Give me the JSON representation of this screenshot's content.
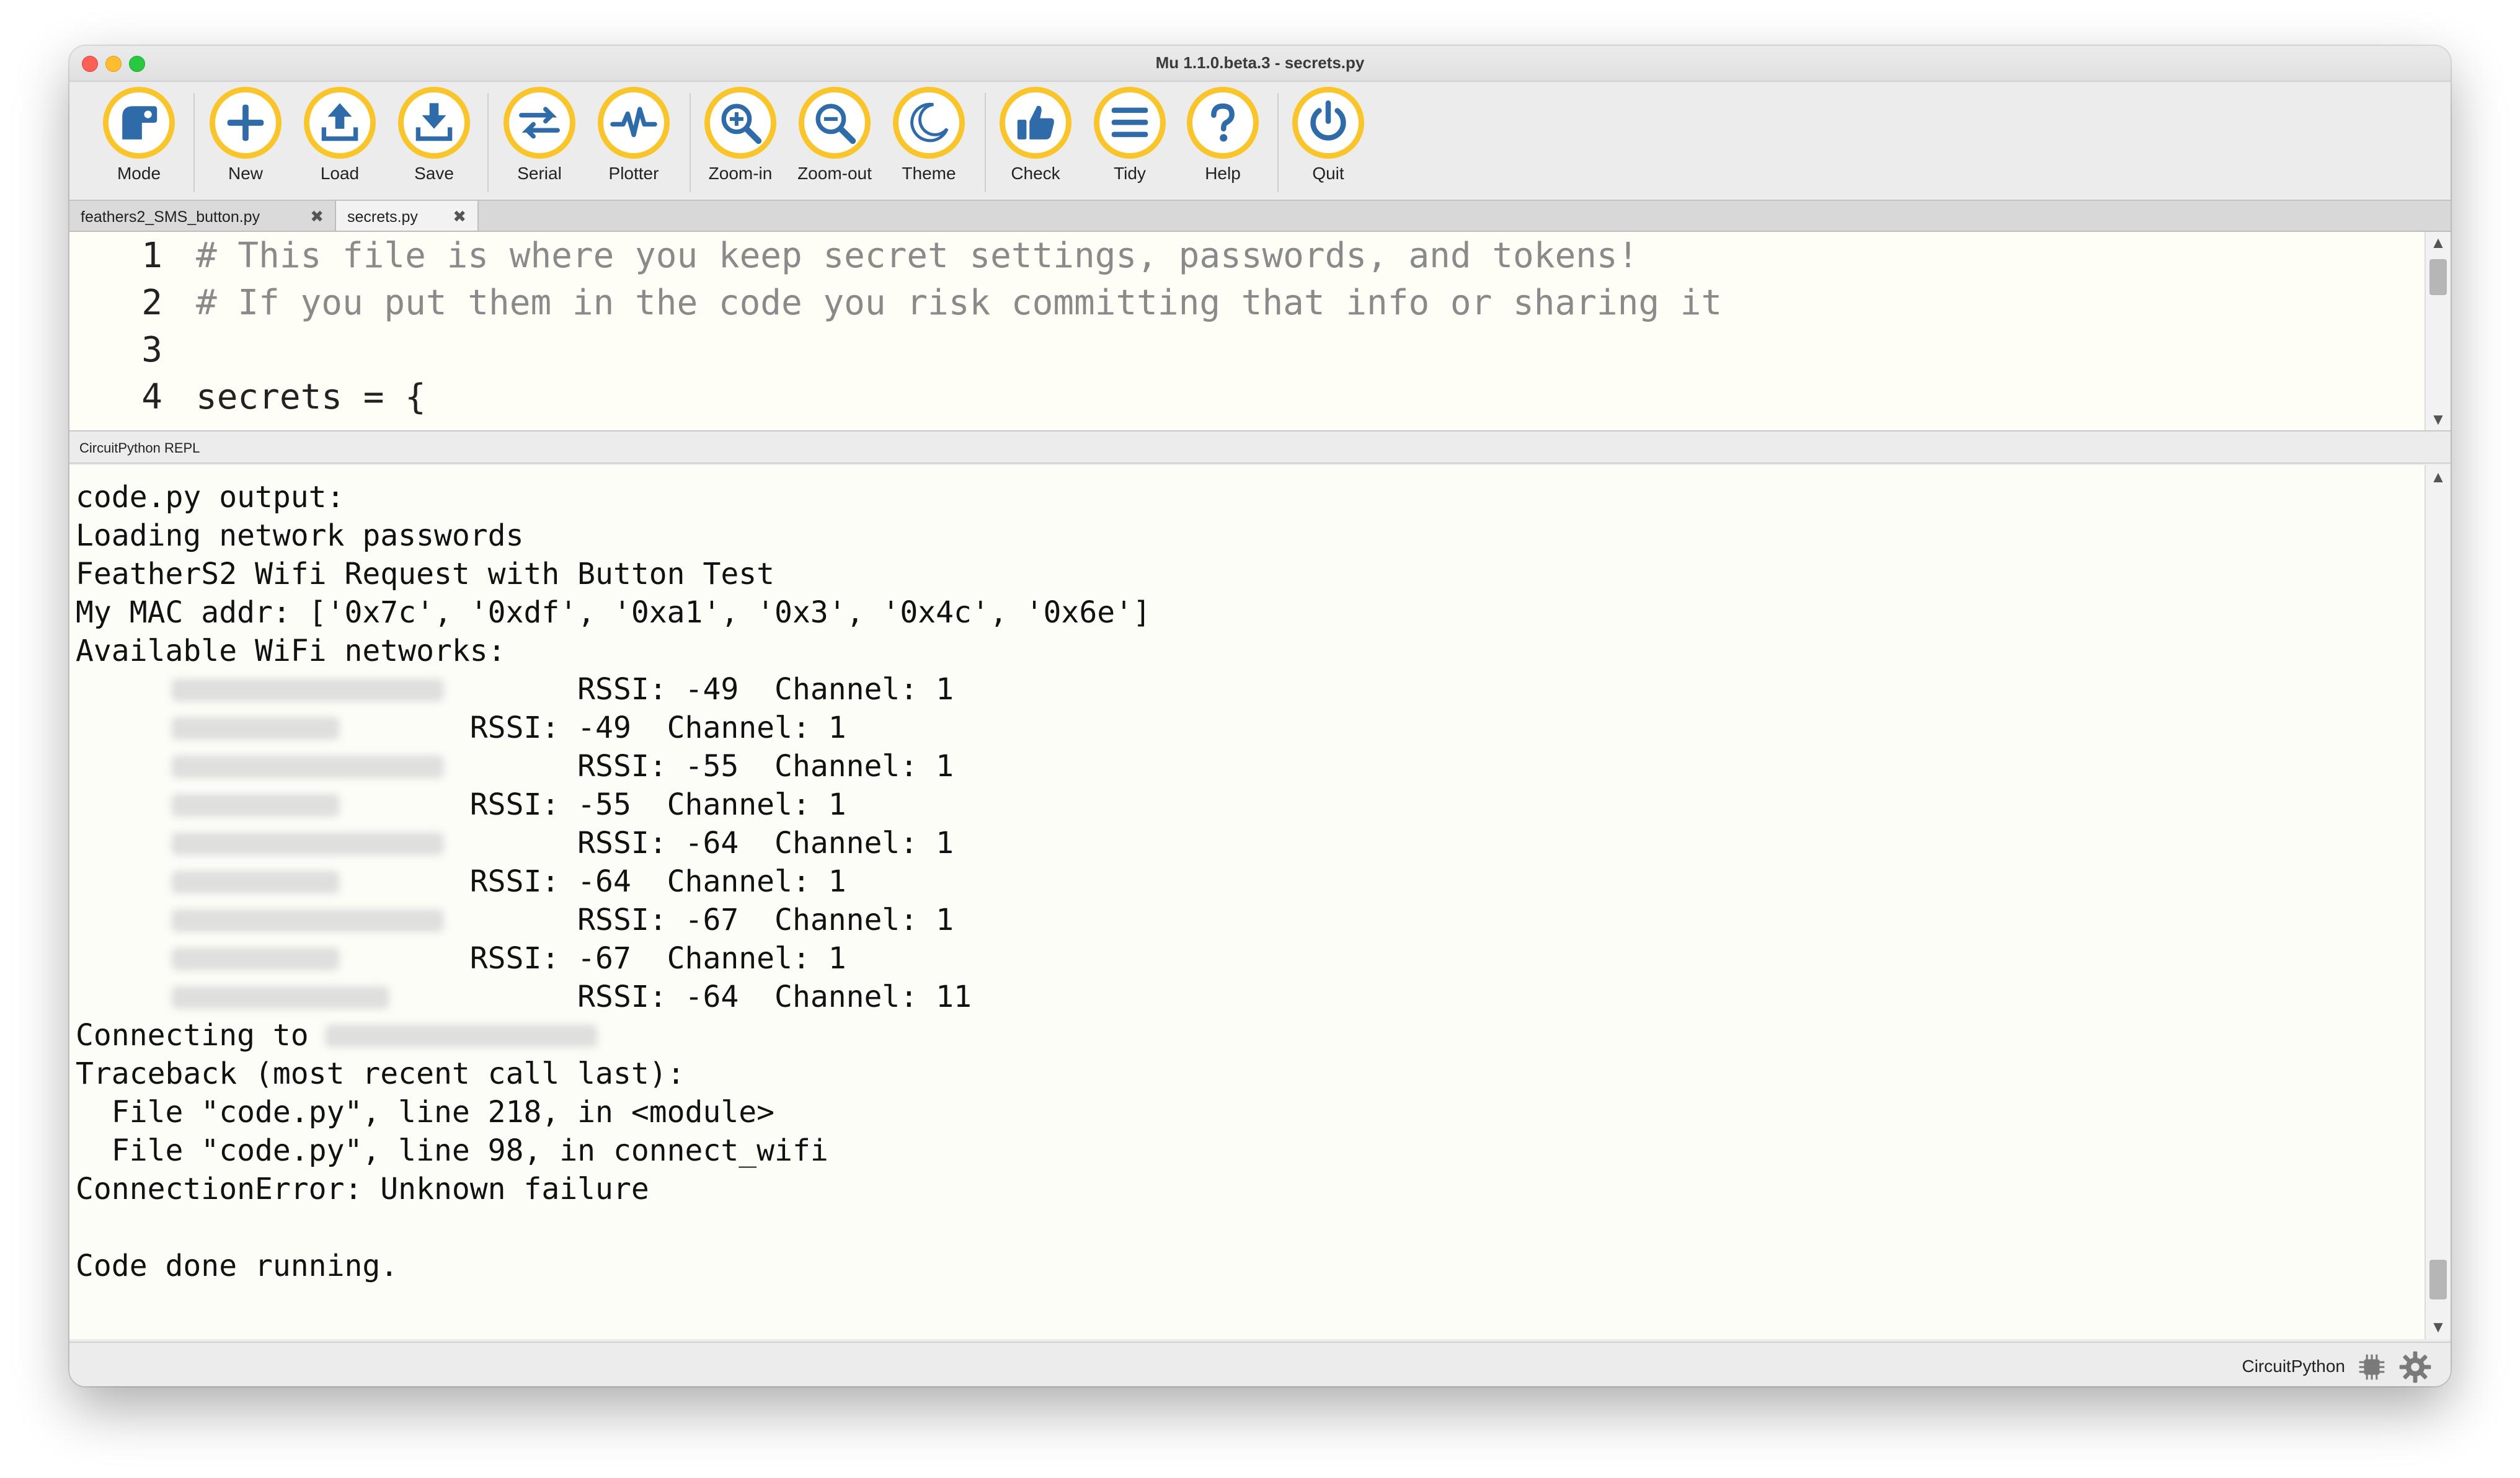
{
  "window": {
    "title": "Mu 1.1.0.beta.3 - secrets.py"
  },
  "toolbar": {
    "buttons": [
      {
        "label": "Mode",
        "icon": "mode-icon"
      },
      {
        "label": "New",
        "icon": "plus-icon"
      },
      {
        "label": "Load",
        "icon": "upload-icon"
      },
      {
        "label": "Save",
        "icon": "download-icon"
      },
      {
        "label": "Serial",
        "icon": "swap-arrows-icon"
      },
      {
        "label": "Plotter",
        "icon": "pulse-icon"
      },
      {
        "label": "Zoom-in",
        "icon": "zoom-in-icon"
      },
      {
        "label": "Zoom-out",
        "icon": "zoom-out-icon"
      },
      {
        "label": "Theme",
        "icon": "moon-icon"
      },
      {
        "label": "Check",
        "icon": "thumbs-up-icon"
      },
      {
        "label": "Tidy",
        "icon": "menu-lines-icon"
      },
      {
        "label": "Help",
        "icon": "question-icon"
      },
      {
        "label": "Quit",
        "icon": "power-icon"
      }
    ],
    "accent_color": "#f9c52a",
    "icon_color": "#2e6ba8"
  },
  "tabs": [
    {
      "label": "feathers2_SMS_button.py",
      "close": "✖"
    },
    {
      "label": "secrets.py",
      "close": "✖"
    }
  ],
  "editor": {
    "lines": [
      {
        "num": "1",
        "text": "# This file is where you keep secret settings, passwords, and tokens!"
      },
      {
        "num": "2",
        "text": "# If you put them in the code you risk committing that info or sharing it"
      },
      {
        "num": "3",
        "text": ""
      },
      {
        "num": "4",
        "text": "secrets = {"
      }
    ]
  },
  "repl": {
    "label": "CircuitPython REPL",
    "lines": [
      "code.py output:",
      "Loading network passwords",
      "FeatherS2 Wifi Request with Button Test",
      "My MAC addr: ['0x7c', '0xdf', '0xa1', '0x3', '0x4c', '0x6e']",
      "Available WiFi networks:",
      "                            RSSI: -49  Channel: 1",
      "                      RSSI: -49  Channel: 1",
      "                            RSSI: -55  Channel: 1",
      "                      RSSI: -55  Channel: 1",
      "                            RSSI: -64  Channel: 1",
      "                      RSSI: -64  Channel: 1",
      "                            RSSI: -67  Channel: 1",
      "                      RSSI: -67  Channel: 1",
      "                            RSSI: -64  Channel: 11",
      "Connecting to",
      "Traceback (most recent call last):",
      "  File \"code.py\", line 218, in <module>",
      "  File \"code.py\", line 98, in connect_wifi",
      "ConnectionError: Unknown failure",
      "",
      "Code done running."
    ]
  },
  "status": {
    "mode": "CircuitPython",
    "chip_icon": "chip-icon",
    "settings_icon": "gear-icon"
  }
}
